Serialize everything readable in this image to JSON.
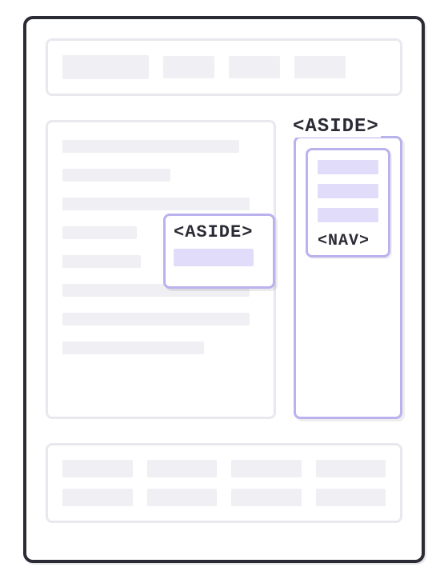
{
  "labels": {
    "aside_outer": "<ASIDE>",
    "aside_inline": "<ASIDE>",
    "nav": "<NAV>"
  },
  "diagram": {
    "type": "html-layout-illustration",
    "sections": [
      "header",
      "main",
      "inline-aside",
      "sidebar-aside",
      "nav",
      "footer"
    ],
    "highlighted_elements": [
      "aside",
      "nav"
    ],
    "colors": {
      "outline_default": "#e8e8ee",
      "outline_highlight": "#b9b2ee",
      "fill_default": "#efeff4",
      "fill_highlight": "#e1dcf9",
      "frame": "#2b2b36"
    }
  }
}
